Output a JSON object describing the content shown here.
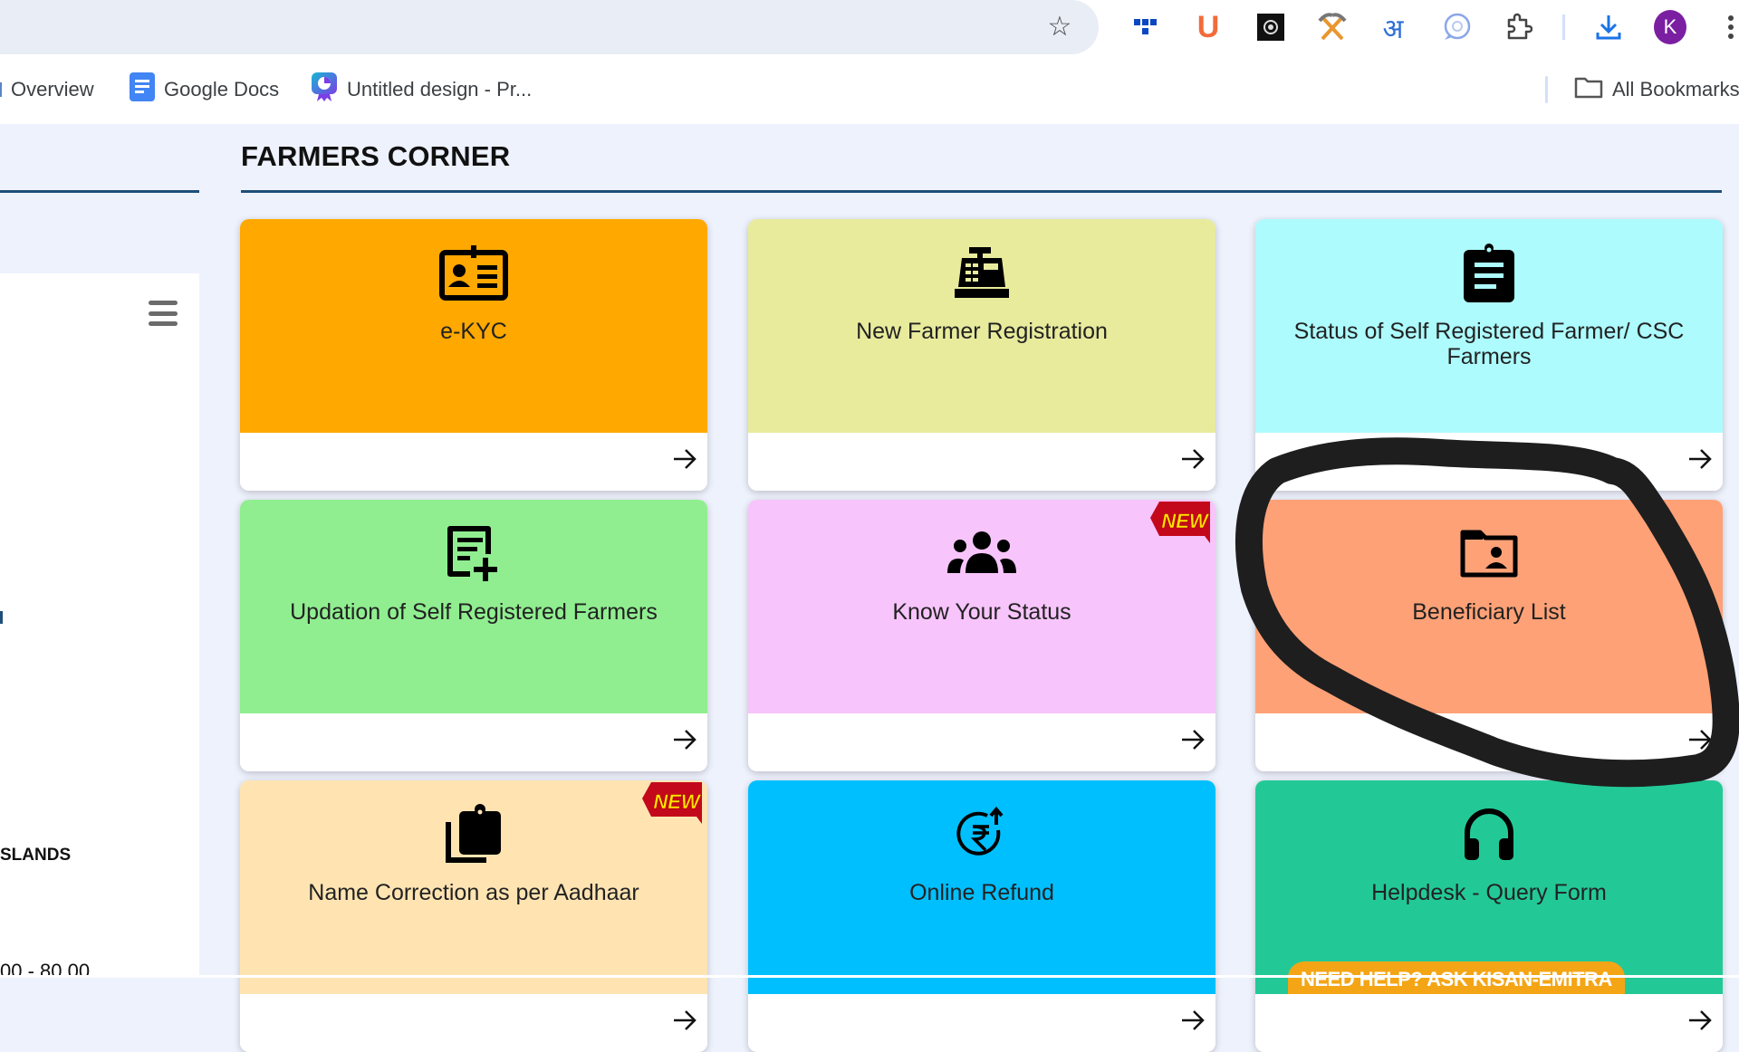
{
  "browser": {
    "bookmark_star_icon": "star-icon",
    "extensions": [
      {
        "name": "dots-extension-icon",
        "color": "#0b47c2"
      },
      {
        "name": "u-extension-icon",
        "label": "U",
        "color": "#f26b3a"
      },
      {
        "name": "ai-extension-icon",
        "color": "#111111"
      },
      {
        "name": "pickaxe-extension-icon",
        "color": "#e8962f"
      },
      {
        "name": "hindi-extension-icon",
        "label": "अ",
        "color": "#2f6fd6"
      },
      {
        "name": "chat-extension-icon",
        "color": "#8aa7e8"
      },
      {
        "name": "puzzle-extensions-icon",
        "color": "#444444"
      }
    ],
    "download_icon": "download-icon",
    "profile_initial": "K",
    "profile_color": "#7b1fa2",
    "menu_icon": "more-vert-icon",
    "bookmarks": [
      {
        "label": "Overview",
        "icon": "overview-icon"
      },
      {
        "label": "Google Docs",
        "icon": "google-docs-icon"
      },
      {
        "label": "Untitled design - Pr...",
        "icon": "canva-icon"
      }
    ],
    "all_bookmarks_label": "All Bookmarks"
  },
  "sidebar": {
    "menu_icon": "hamburger-icon",
    "text_islands": "SLANDS",
    "text_range": "00 - 80.00"
  },
  "main": {
    "title": "FARMERS CORNER",
    "cards": [
      {
        "label": "e-KYC",
        "icon": "id-card-icon",
        "color": "#ffa800",
        "new": false
      },
      {
        "label": "New Farmer Registration",
        "icon": "cash-register-icon",
        "color": "#e8eb9c",
        "new": false
      },
      {
        "label": "Status of Self Registered Farmer/ CSC Farmers",
        "icon": "clipboard-list-icon",
        "color": "#adfbfd",
        "new": false
      },
      {
        "label": "Updation of Self Registered Farmers",
        "icon": "note-add-icon",
        "color": "#90ee90",
        "new": false
      },
      {
        "label": "Know Your Status",
        "icon": "group-icon",
        "color": "#f7c4fb",
        "new": true
      },
      {
        "label": "Beneficiary List",
        "icon": "folder-user-icon",
        "color": "#ffa177",
        "new": false,
        "highlighted": true
      },
      {
        "label": "Name Correction as per Aadhaar",
        "icon": "copy-clipboard-icon",
        "color": "#ffe4b2",
        "new": true
      },
      {
        "label": "Online Refund",
        "icon": "rupee-refund-icon",
        "color": "#00bfff",
        "new": false
      },
      {
        "label": "Helpdesk - Query Form",
        "icon": "headphones-icon",
        "color": "#22c997",
        "new": false,
        "pill": "NEED HELP? ASK KISAN-EMITRA"
      }
    ],
    "new_badge_label": "NEW",
    "badge_color": "#c4081c",
    "badge_text_color": "#ffe600"
  },
  "annotation": {
    "stroke_color": "#1e1e1e"
  }
}
